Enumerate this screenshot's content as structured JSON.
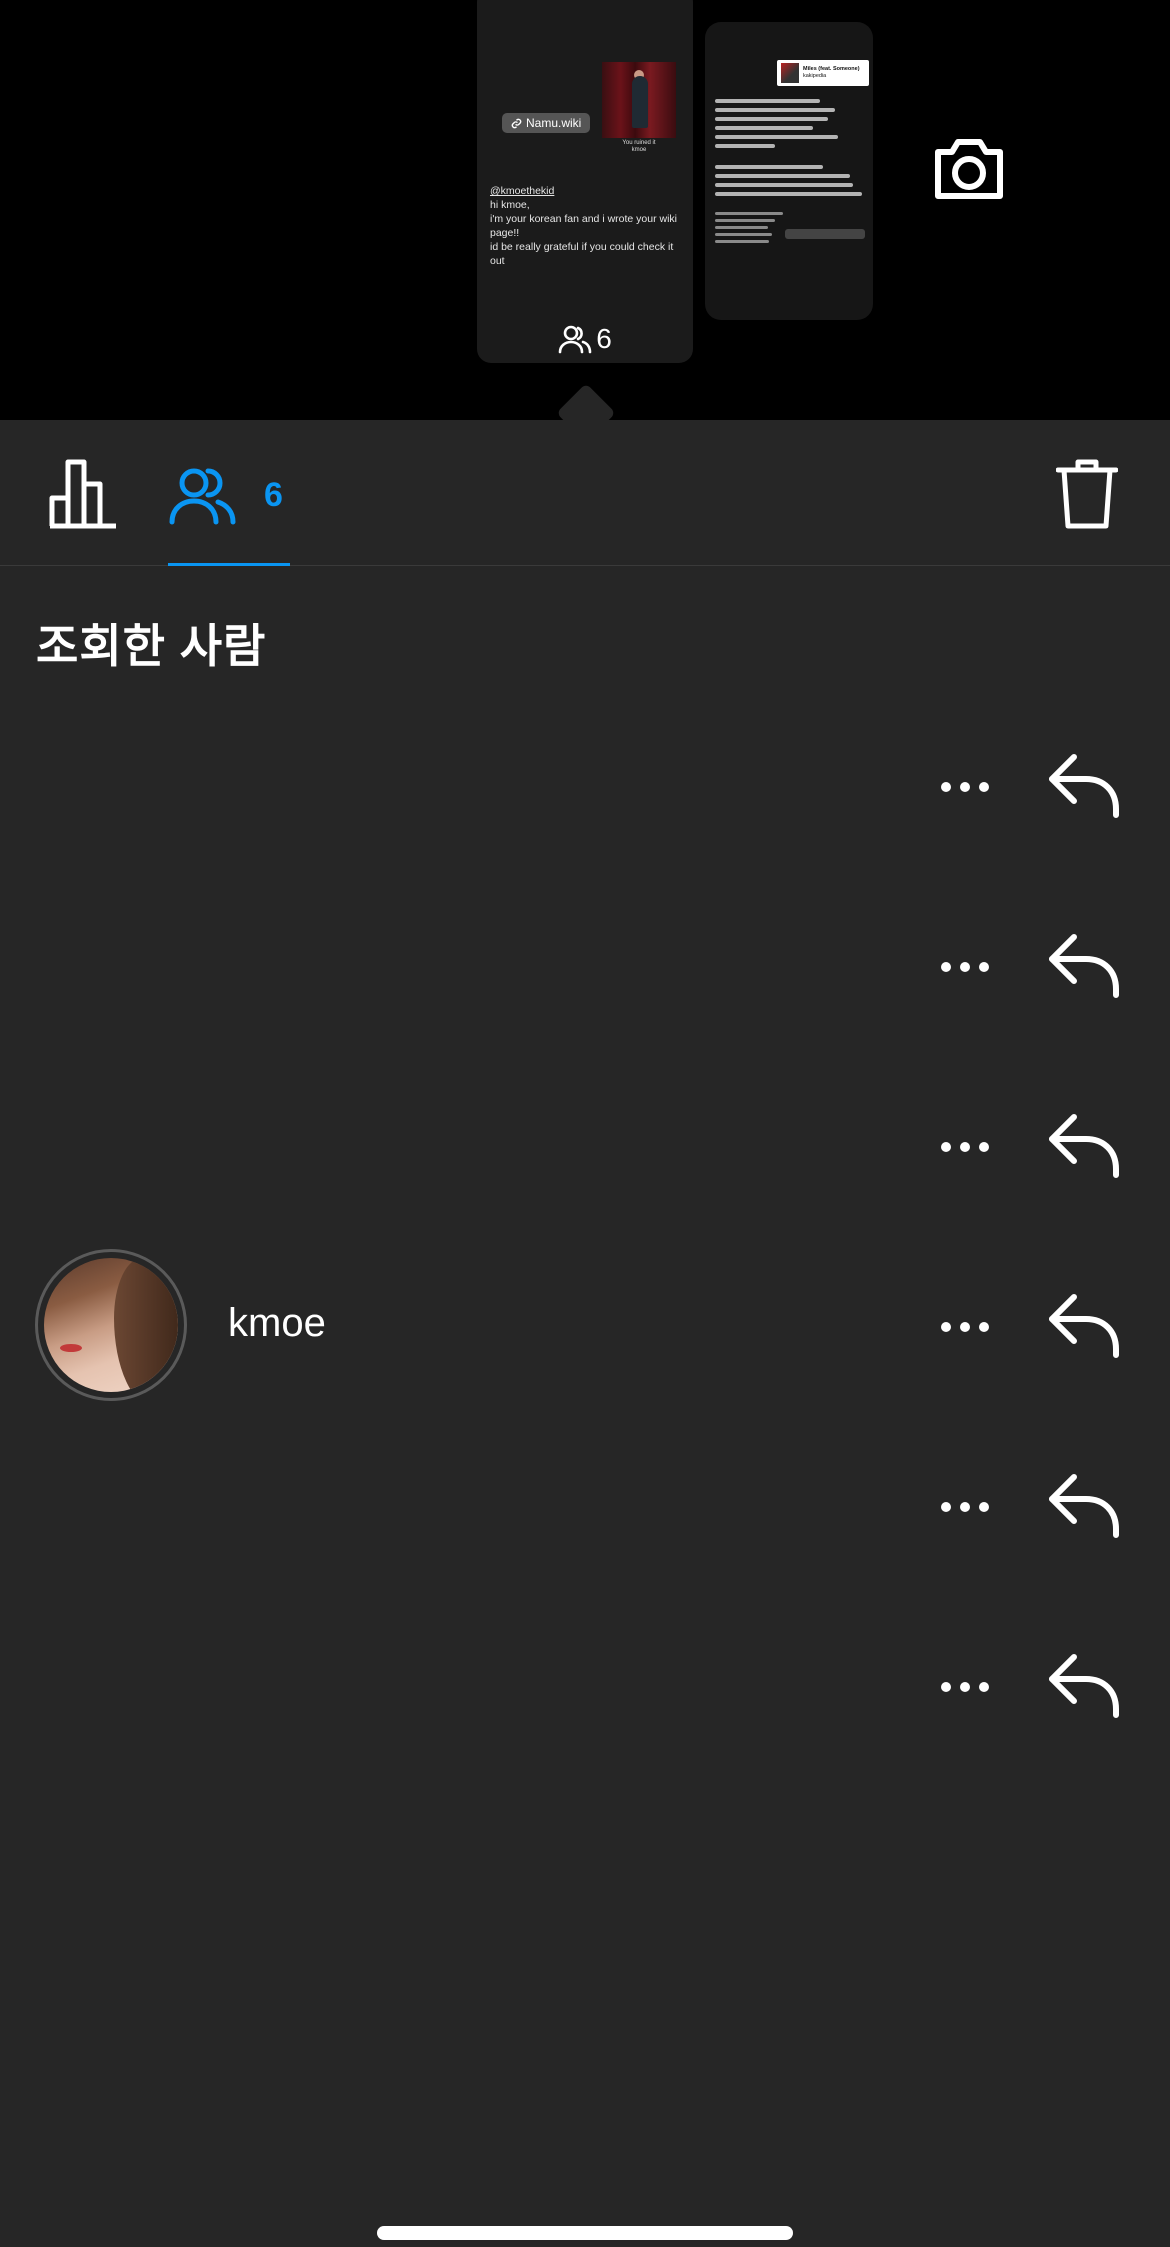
{
  "story_preview": {
    "link_sticker_label": "Namu.wiki",
    "photo_caption_line1": "You ruined it",
    "photo_caption_line2": "kmoe",
    "text_mention": "@kmoethekid",
    "text_line1": "hi kmoe,",
    "text_line2": "i'm your korean fan and i wrote your wiki page!!",
    "text_line3": "id be really grateful if you could check it out",
    "viewer_count": "6",
    "side_card_title": "Miles (feat. Someone)",
    "side_card_sub": "kakipedia"
  },
  "tabs": {
    "viewers_count": "6",
    "active": "viewers"
  },
  "section_title": "조회한 사람",
  "viewers": [
    {
      "username": "",
      "has_avatar": false
    },
    {
      "username": "",
      "has_avatar": false
    },
    {
      "username": "",
      "has_avatar": false
    },
    {
      "username": "kmoe",
      "has_avatar": true
    },
    {
      "username": "",
      "has_avatar": false
    },
    {
      "username": "",
      "has_avatar": false
    }
  ],
  "colors": {
    "accent": "#0a95f2",
    "sheet_background": "#262626",
    "top_background": "#000000"
  },
  "icons": {
    "insights": "bar-chart-icon",
    "viewers": "people-icon",
    "delete": "trash-icon",
    "camera": "camera-icon",
    "more": "more-horizontal-icon",
    "reply": "reply-arrow-icon"
  }
}
